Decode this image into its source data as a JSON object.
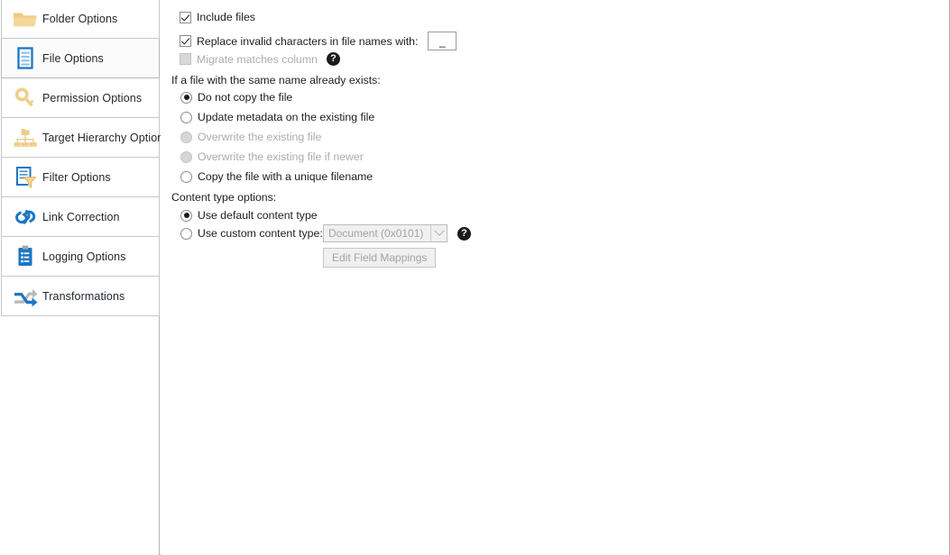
{
  "sidebar": {
    "items": [
      {
        "label": "Folder Options",
        "icon": "folder-icon",
        "selected": false
      },
      {
        "label": "File Options",
        "icon": "file-document-icon",
        "selected": true
      },
      {
        "label": "Permission Options",
        "icon": "key-icon",
        "selected": false
      },
      {
        "label": "Target Hierarchy Options",
        "icon": "hierarchy-tree-icon",
        "selected": false
      },
      {
        "label": "Filter Options",
        "icon": "filter-funnel-icon",
        "selected": false
      },
      {
        "label": "Link Correction",
        "icon": "chain-link-icon",
        "selected": false
      },
      {
        "label": "Logging Options",
        "icon": "clipboard-list-icon",
        "selected": false
      },
      {
        "label": "Transformations",
        "icon": "shuffle-arrows-icon",
        "selected": false
      }
    ]
  },
  "main": {
    "include_files": {
      "label": "Include files",
      "checked": true,
      "enabled": true
    },
    "replace_invalid": {
      "label": "Replace invalid characters in file names with:",
      "checked": true,
      "enabled": true,
      "value": "_"
    },
    "migrate_matches": {
      "label": "Migrate matches column",
      "checked": false,
      "enabled": false,
      "help_icon": "help-question-icon"
    },
    "duplicate_group": {
      "label": "If a file with the same name already exists:",
      "options": [
        {
          "label": "Do not copy the file",
          "selected": true,
          "enabled": true
        },
        {
          "label": "Update metadata on the existing file",
          "selected": false,
          "enabled": true
        },
        {
          "label": "Overwrite the existing file",
          "selected": false,
          "enabled": false
        },
        {
          "label": "Overwrite the existing file if newer",
          "selected": false,
          "enabled": false
        },
        {
          "label": "Copy the file with a unique filename",
          "selected": false,
          "enabled": true
        }
      ]
    },
    "content_type_group": {
      "label": "Content type options:",
      "options": [
        {
          "label": "Use default content type",
          "selected": true,
          "enabled": true
        },
        {
          "label": "Use custom content type:",
          "selected": false,
          "enabled": true
        }
      ],
      "combo_value": "Document (0x0101)",
      "combo_enabled": false,
      "combo_arrow_icon": "chevron-down-icon",
      "help_icon": "help-question-icon",
      "edit_mappings_button": "Edit Field Mappings",
      "edit_mappings_enabled": false
    }
  },
  "colors": {
    "accent_blue": "#1b76c4",
    "folder_yellow": "#f3cf85",
    "panel_border": "#c8c8c8",
    "text": "#1c1c1c",
    "disabled_text": "#acacac"
  }
}
